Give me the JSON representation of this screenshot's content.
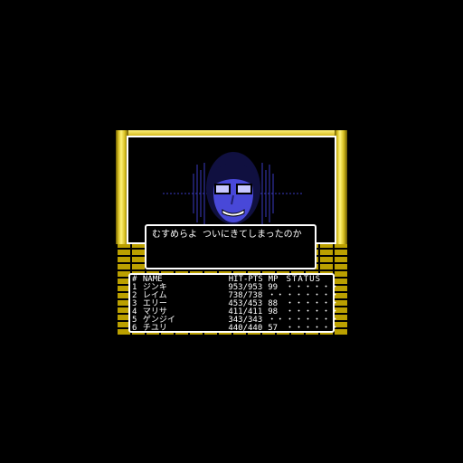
{
  "message": "むすめらよ ついにきてしまったのか",
  "party": {
    "headers": {
      "num": "#",
      "name": "NAME",
      "hp": "HIT-PTS",
      "mp": "MP",
      "status": "STATUS"
    },
    "members": [
      {
        "num": "1",
        "name": "ジンキ",
        "hp": "953/953",
        "mp": "99",
        "status": "・・・・・・"
      },
      {
        "num": "2",
        "name": "レイム",
        "hp": "738/738",
        "mp": "・・",
        "status": "・・・・・・"
      },
      {
        "num": "3",
        "name": "エリー",
        "hp": "453/453",
        "mp": "88",
        "status": "・・・・・・"
      },
      {
        "num": "4",
        "name": "マリサ",
        "hp": "411/411",
        "mp": "98",
        "status": "・・・・・・"
      },
      {
        "num": "5",
        "name": "ゲンジイ",
        "hp": "343/343",
        "mp": "・・",
        "status": "・・・・・・"
      },
      {
        "num": "6",
        "name": "チユリ",
        "hp": "440/440",
        "mp": "57",
        "status": "・・・・・・"
      }
    ]
  },
  "colors": {
    "gold": "#d8c020",
    "monster": "#4848d8"
  },
  "icons": {
    "enemy": "spectral-face"
  }
}
